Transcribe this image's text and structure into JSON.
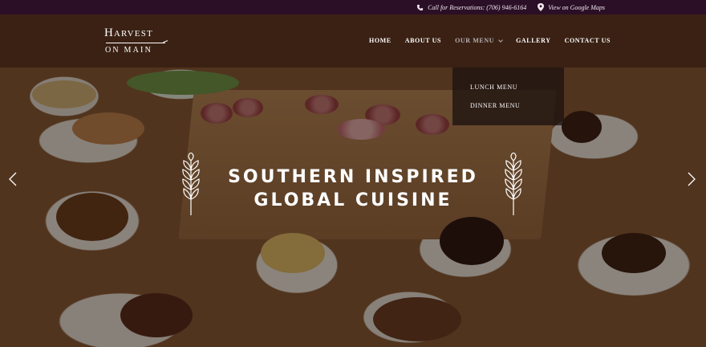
{
  "topbar": {
    "reservation": "Call for Reservations: (706) 946-6164",
    "maps": "View on Google Maps",
    "bg_color": "#2b0f27"
  },
  "logo": {
    "line1_first": "H",
    "line1_rest": "ARVEST",
    "line2": "ON MAIN"
  },
  "nav": {
    "items": [
      {
        "label": "HOME"
      },
      {
        "label": "ABOUT US"
      },
      {
        "label": "OUR MENU"
      },
      {
        "label": "GALLERY"
      },
      {
        "label": "CONTACT US"
      }
    ],
    "dropdown": [
      "LUNCH MENU",
      "DINNER MENU"
    ]
  },
  "hero": {
    "line1": "SOUTHERN INSPIRED",
    "line2": "GLOBAL CUISINE"
  },
  "icons": {
    "phone": "phone-icon",
    "map_pin": "map-pin-icon",
    "wheat": "wheat-icon",
    "prev": "chevron-left-icon",
    "next": "chevron-right-icon"
  }
}
